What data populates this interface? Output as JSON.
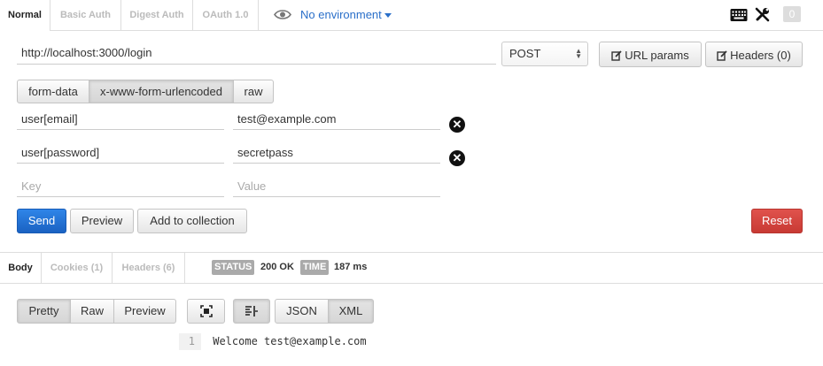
{
  "auth_tabs": [
    {
      "label": "Normal"
    },
    {
      "label": "Basic Auth"
    },
    {
      "label": "Digest Auth"
    },
    {
      "label": "OAuth 1.0"
    }
  ],
  "environment": {
    "label": "No environment"
  },
  "toolbar": {
    "badge_count": "0"
  },
  "request": {
    "url": "http://localhost:3000/login",
    "method": "POST",
    "url_params_label": "URL params",
    "headers_label": "Headers (0)"
  },
  "body_tabs": [
    {
      "label": "form-data"
    },
    {
      "label": "x-www-form-urlencoded"
    },
    {
      "label": "raw"
    }
  ],
  "params": [
    {
      "key": "user[email]",
      "value": "test@example.com"
    },
    {
      "key": "user[password]",
      "value": "secretpass"
    }
  ],
  "new_param": {
    "key_placeholder": "Key",
    "value_placeholder": "Value"
  },
  "actions": {
    "send": "Send",
    "preview": "Preview",
    "add_to_collection": "Add to collection",
    "reset": "Reset"
  },
  "response_tabs": [
    {
      "label": "Body"
    },
    {
      "label": "Cookies (1)"
    },
    {
      "label": "Headers (6)"
    }
  ],
  "response_status": {
    "status_label": "STATUS",
    "status_value": "200 OK",
    "time_label": "TIME",
    "time_value": "187 ms"
  },
  "view_modes": {
    "pretty": "Pretty",
    "raw": "Raw",
    "preview": "Preview"
  },
  "format_modes": {
    "json": "JSON",
    "xml": "XML"
  },
  "response_body": [
    {
      "line": "1",
      "text": "Welcome test@example.com"
    }
  ],
  "colors": {
    "send": "#1f6fd1",
    "reset": "#d43f3a",
    "link": "#2a6fc9"
  }
}
